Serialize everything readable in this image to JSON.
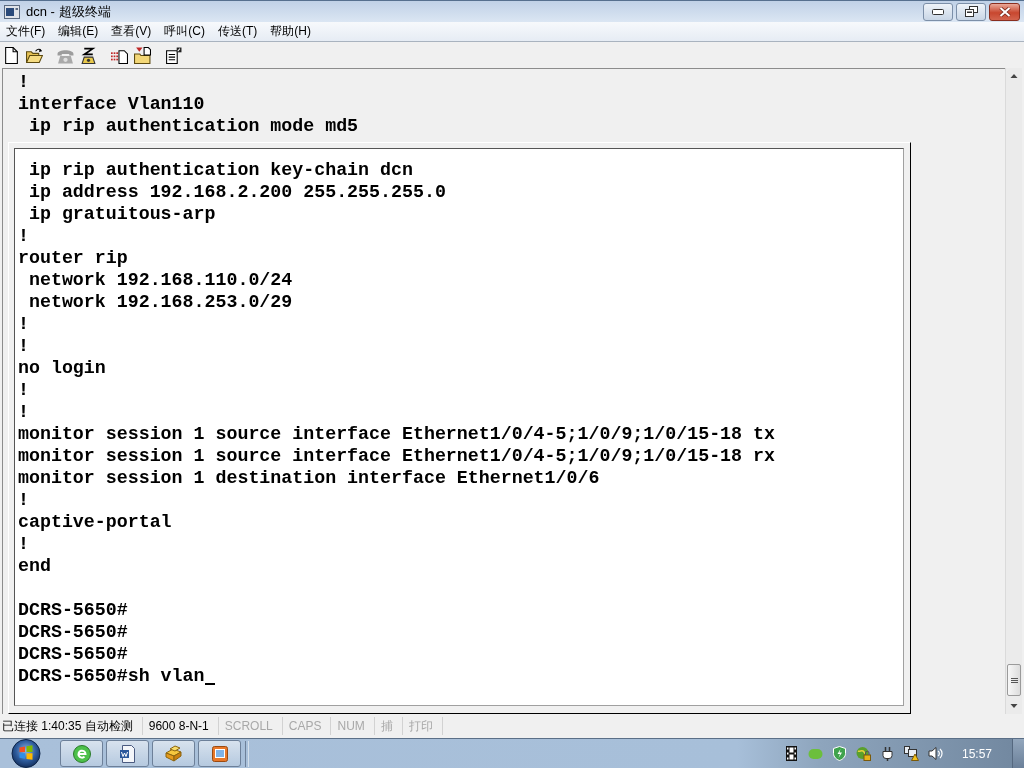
{
  "window": {
    "title": "dcn - 超级终端"
  },
  "menu": [
    "文件(F)",
    "编辑(E)",
    "查看(V)",
    "呼叫(C)",
    "传送(T)",
    "帮助(H)"
  ],
  "toolbar": [
    [
      {
        "kind": "new",
        "disabled": false
      },
      {
        "kind": "open",
        "disabled": false
      }
    ],
    [
      {
        "kind": "call",
        "disabled": true
      },
      {
        "kind": "hangup",
        "disabled": false
      }
    ],
    [
      {
        "kind": "send",
        "disabled": false
      },
      {
        "kind": "receive",
        "disabled": false
      }
    ],
    [
      {
        "kind": "properties",
        "disabled": false
      }
    ]
  ],
  "terminal": {
    "lines": [
      "!",
      "interface Vlan110",
      " ip rip authentication mode md5"
    ],
    "panel": {
      "groups": [
        {
          "lines": [
            " ip rip authentication key-chain dcn",
            " ip address 192.168.2.200 255.255.255.0",
            " ip gratuitous-arp",
            "!",
            "router rip",
            " network 192.168.110.0/24",
            " network 192.168.253.0/29",
            "!",
            "!",
            "no login",
            "!",
            "!",
            "monitor session 1 source interface Ethernet1/0/4-5;1/0/9;1/0/15-18 tx",
            "monitor session 1 source interface Ethernet1/0/4-5;1/0/9;1/0/15-18 rx",
            "monitor session 1 destination interface Ethernet1/0/6",
            "!",
            "captive-portal",
            "!",
            "end"
          ]
        },
        {
          "lines": [
            "DCRS-5650#",
            "DCRS-5650#",
            "DCRS-5650#",
            "DCRS-5650#sh vlan"
          ]
        }
      ],
      "cursor": true
    }
  },
  "status_bar": [
    {
      "text": "已连接 1:40:35 自动检测",
      "disabled": false
    },
    {
      "text": "9600 8-N-1",
      "disabled": false
    },
    {
      "text": "SCROLL",
      "disabled": true
    },
    {
      "text": "CAPS",
      "disabled": true
    },
    {
      "text": "NUM",
      "disabled": true
    },
    {
      "text": "捕",
      "disabled": true
    },
    {
      "text": "打印",
      "disabled": true
    }
  ],
  "taskbar": {
    "clock": "15:57"
  }
}
